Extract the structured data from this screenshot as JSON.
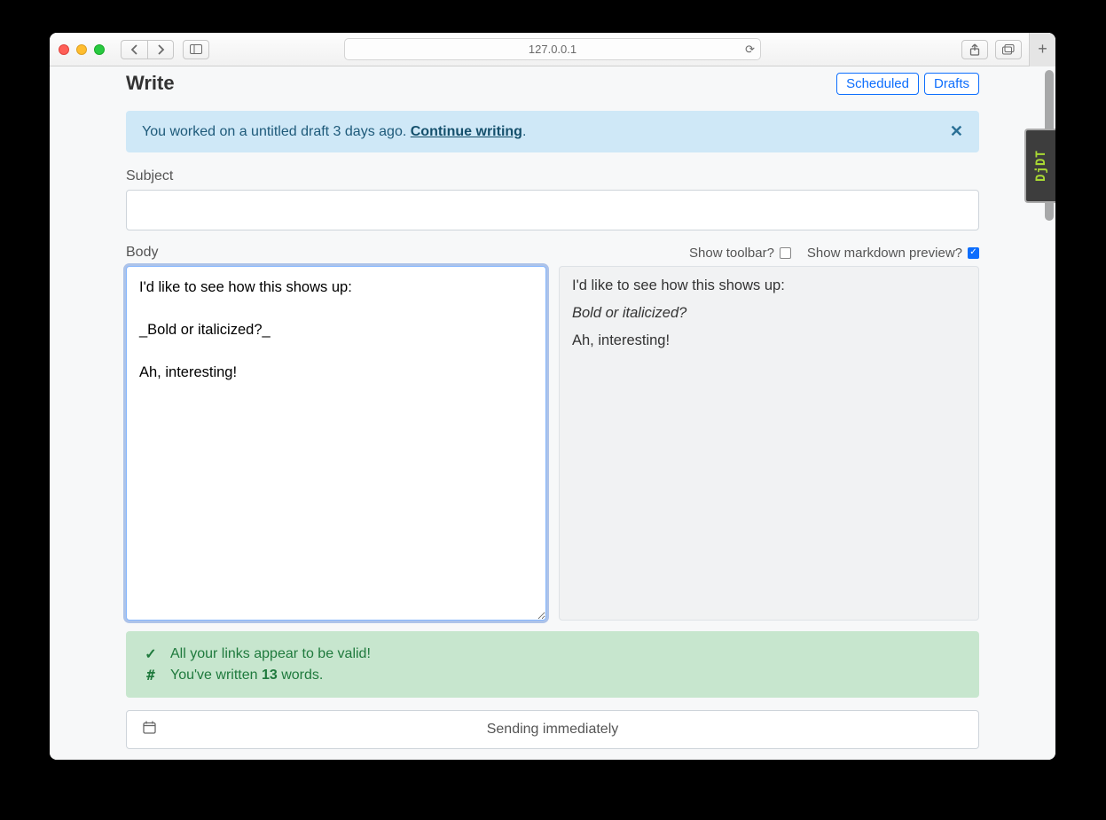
{
  "browser": {
    "address": "127.0.0.1",
    "badge": "DjDT"
  },
  "page": {
    "title": "Write",
    "header_buttons": {
      "scheduled": "Scheduled",
      "drafts": "Drafts"
    }
  },
  "alert_draft": {
    "prefix": "You worked on a untitled draft 3 days ago. ",
    "link": "Continue writing",
    "suffix": "."
  },
  "form": {
    "subject_label": "Subject",
    "subject_value": "",
    "body_label": "Body",
    "toggles": {
      "toolbar_label": "Show toolbar?",
      "toolbar_checked": false,
      "preview_label": "Show markdown preview?",
      "preview_checked": true
    },
    "body_value": "I'd like to see how this shows up:\n\n_Bold or italicized?_\n\nAh, interesting!",
    "preview": {
      "line1": "I'd like to see how this shows up:",
      "line2_italic": "Bold or italicized?",
      "line3": "Ah, interesting!"
    }
  },
  "status": {
    "links_valid": "All your links appear to be valid!",
    "word_count_prefix": "You've written ",
    "word_count": "13",
    "word_count_suffix": " words."
  },
  "schedule": {
    "text": "Sending immediately"
  }
}
